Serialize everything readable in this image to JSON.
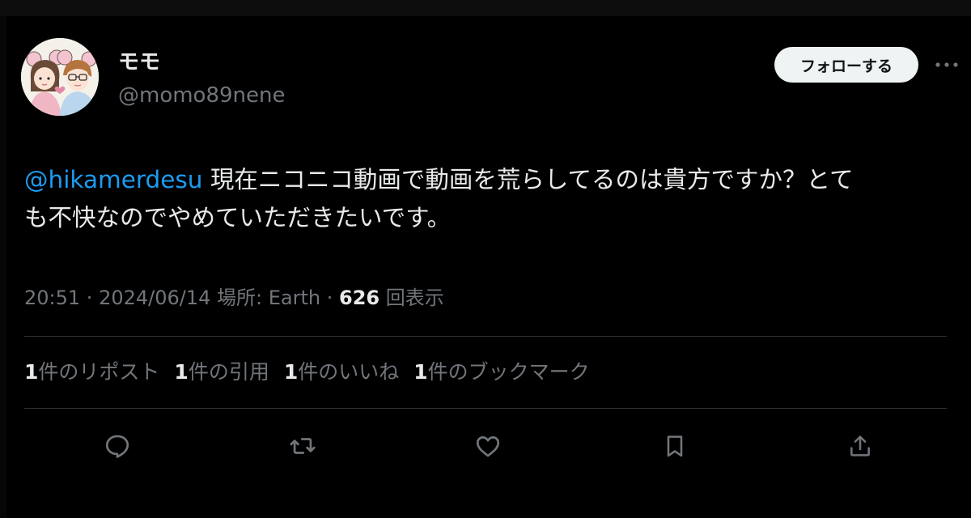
{
  "author": {
    "display_name": "モモ",
    "handle": "@momo89nene",
    "avatar_icon": "avatar-illustration"
  },
  "follow_button": {
    "label": "フォローする"
  },
  "more_icon": "more-horizontal-icon",
  "tweet": {
    "mention": "@hikamerdesu",
    "text_line1": " 現在ニコニコ動画で動画を荒らしてるのは貴方ですか？とて",
    "text_line2": "も不快なのでやめていただきたいです。"
  },
  "meta": {
    "time": "20:51",
    "separator": " · ",
    "date": "2024/06/14",
    "location_label": "場所: Earth",
    "views_count": "626",
    "views_label": "回表示"
  },
  "stats": [
    {
      "count": "1",
      "label": "件のリポスト"
    },
    {
      "count": "1",
      "label": "件の引用"
    },
    {
      "count": "1",
      "label": "件のいいね"
    },
    {
      "count": "1",
      "label": "件のブックマーク"
    }
  ],
  "actions": [
    {
      "icon": "reply-icon"
    },
    {
      "icon": "repost-icon"
    },
    {
      "icon": "like-icon"
    },
    {
      "icon": "bookmark-icon"
    },
    {
      "icon": "share-icon"
    }
  ],
  "colors": {
    "background": "#000000",
    "text_primary": "#e7e9ea",
    "text_secondary": "#71767b",
    "link": "#1d9bf0",
    "divider": "#2f3336",
    "button_bg": "#eff3f4"
  }
}
